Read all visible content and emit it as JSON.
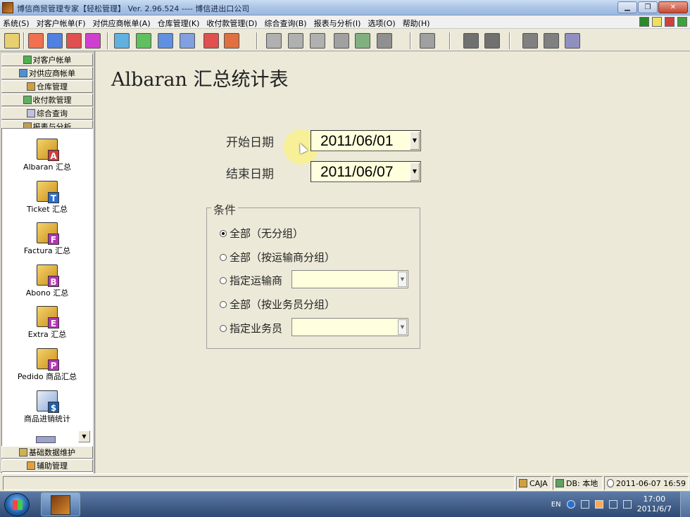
{
  "window": {
    "title": "博信商贸管理专家【轻松管理】 Ver. 2.96.524 ---- 博信进出口公司",
    "minimize": "▁",
    "restore": "❐",
    "close": "✕"
  },
  "menu": [
    "系统(S)",
    "对客户帐单(F)",
    "对供应商帐单(A)",
    "仓库管理(K)",
    "收付款管理(D)",
    "综合查询(B)",
    "报表与分析(I)",
    "选项(O)",
    "帮助(H)"
  ],
  "toolbar_icons": [
    "exit-icon",
    "albaran-a-icon",
    "factura-f-icon",
    "ticket-b-icon",
    "pedido-p-icon",
    "report1-icon",
    "report2-icon",
    "report3-icon",
    "report4-icon",
    "money-icon",
    "euro-icon",
    "doc1-icon",
    "doc2-icon",
    "doc3-icon",
    "doc4-icon",
    "doc5-icon",
    "settings-icon",
    "print-icon",
    "arrow-left-icon",
    "arrow-right-icon",
    "users1-icon",
    "users2-icon",
    "users3-icon"
  ],
  "nav": {
    "top_buttons": [
      "对客户帐单",
      "对供应商帐单",
      "仓库管理",
      "收付款管理",
      "综合查询",
      "报表与分析"
    ],
    "items": [
      {
        "label": "Albaran 汇总",
        "letter": "A",
        "color": "#d43a3a"
      },
      {
        "label": "Ticket 汇总",
        "letter": "T",
        "color": "#2b6fd1"
      },
      {
        "label": "Factura 汇总",
        "letter": "F",
        "color": "#b832b8"
      },
      {
        "label": "Abono 汇总",
        "letter": "B",
        "color": "#b832b8"
      },
      {
        "label": "Extra 汇总",
        "letter": "E",
        "color": "#b832b8"
      },
      {
        "label": "Pedido 商品汇总",
        "letter": "P",
        "color": "#b832b8"
      },
      {
        "label": "商品进销统计",
        "letter": "$",
        "color": "#1f5fa8"
      }
    ],
    "scroll_down": "▼",
    "bottom_buttons": [
      "基础数据维护",
      "辅助管理"
    ]
  },
  "main": {
    "title": "Albaran 汇总统计表",
    "start_label": "开始日期",
    "start_value": "2011/06/01",
    "end_label": "结束日期",
    "end_value": "2011/06/07",
    "drop_glyph": "▼",
    "group_title": "条件",
    "options": [
      "全部（无分组）",
      "全部（按运输商分组）",
      "指定运输商",
      "全部（按业务员分组）",
      "指定业务员"
    ],
    "selected_option": 0
  },
  "status": {
    "caja": "CAJA",
    "db": "DB: 本地",
    "datetime": "2011-06-07 16:59"
  },
  "taskbar": {
    "lang": "EN",
    "time": "17:00",
    "date": "2011/6/7"
  }
}
